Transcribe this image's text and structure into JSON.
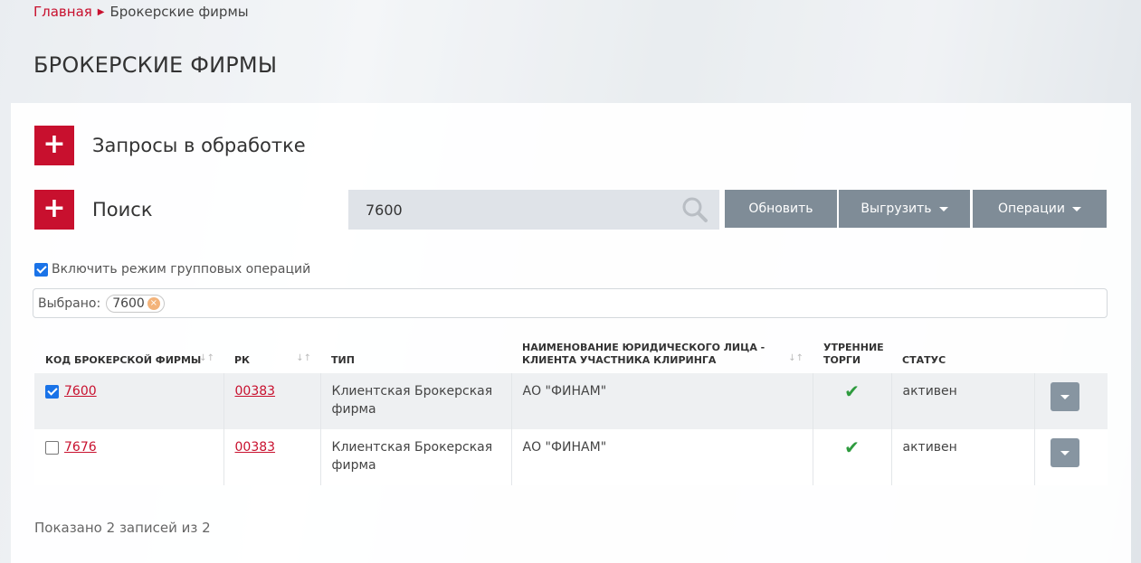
{
  "breadcrumb": {
    "home": "Главная",
    "current": "Брокерские фирмы"
  },
  "page_title": "БРОКЕРСКИЕ ФИРМЫ",
  "sections": {
    "requests_label": "Запросы в обработке",
    "search_label": "Поиск",
    "plus_symbol": "+"
  },
  "search": {
    "value": "7600"
  },
  "toolbar": {
    "refresh": "Обновить",
    "export": "Выгрузить",
    "operations": "Операции"
  },
  "group_mode": {
    "label": "Включить режим групповых операций",
    "checked": true
  },
  "selected": {
    "label": "Выбрано:",
    "tags": [
      "7600"
    ]
  },
  "table": {
    "columns": [
      "КОД БРОКЕРСКОЙ ФИРМЫ",
      "РК",
      "ТИП",
      "НАИМЕНОВАНИЕ ЮРИДИЧЕСКОГО ЛИЦА - КЛИЕНТА УЧАСТНИКА КЛИРИНГА",
      "УТРЕННИЕ ТОРГИ",
      "СТАТУС"
    ],
    "rows": [
      {
        "code": "7600",
        "checked": true,
        "rk": "00383",
        "type": "Клиентская Брокерская фирма",
        "name": "АО \"ФИНАМ\"",
        "morning": "✔",
        "status": "активен"
      },
      {
        "code": "7676",
        "checked": false,
        "rk": "00383",
        "type": "Клиентская Брокерская фирма",
        "name": "АО \"ФИНАМ\"",
        "morning": "✔",
        "status": "активен"
      }
    ]
  },
  "footer": {
    "count_text": "Показано 2 записей из 2"
  },
  "colors": {
    "brand_red": "#c8102e",
    "button_gray": "#7f8c97",
    "check_green": "#2e9b3e"
  }
}
